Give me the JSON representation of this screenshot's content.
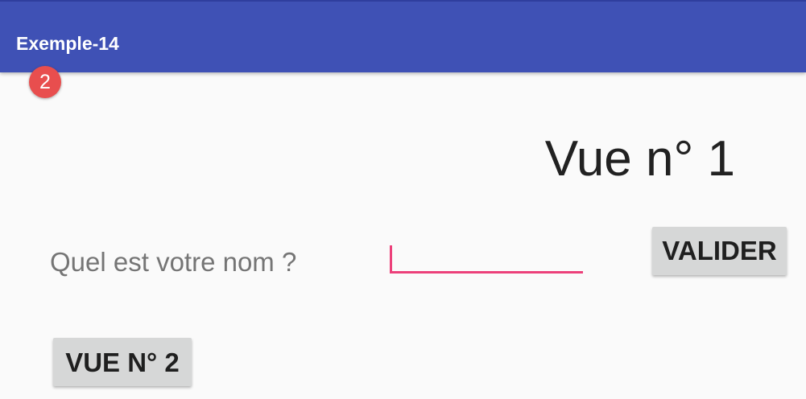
{
  "app_bar": {
    "title": "Exemple-14",
    "accent_color": "#3f51b5"
  },
  "badge": {
    "count": "2",
    "color": "#e84e4e"
  },
  "content": {
    "view_title": "Vue n° 1",
    "question_label": "Quel est votre nom ?",
    "name_input": {
      "value": "",
      "placeholder": "",
      "underline_color": "#ec407a"
    },
    "validate_button_label": "VALIDER",
    "view2_button_label": "VUE N° 2"
  }
}
